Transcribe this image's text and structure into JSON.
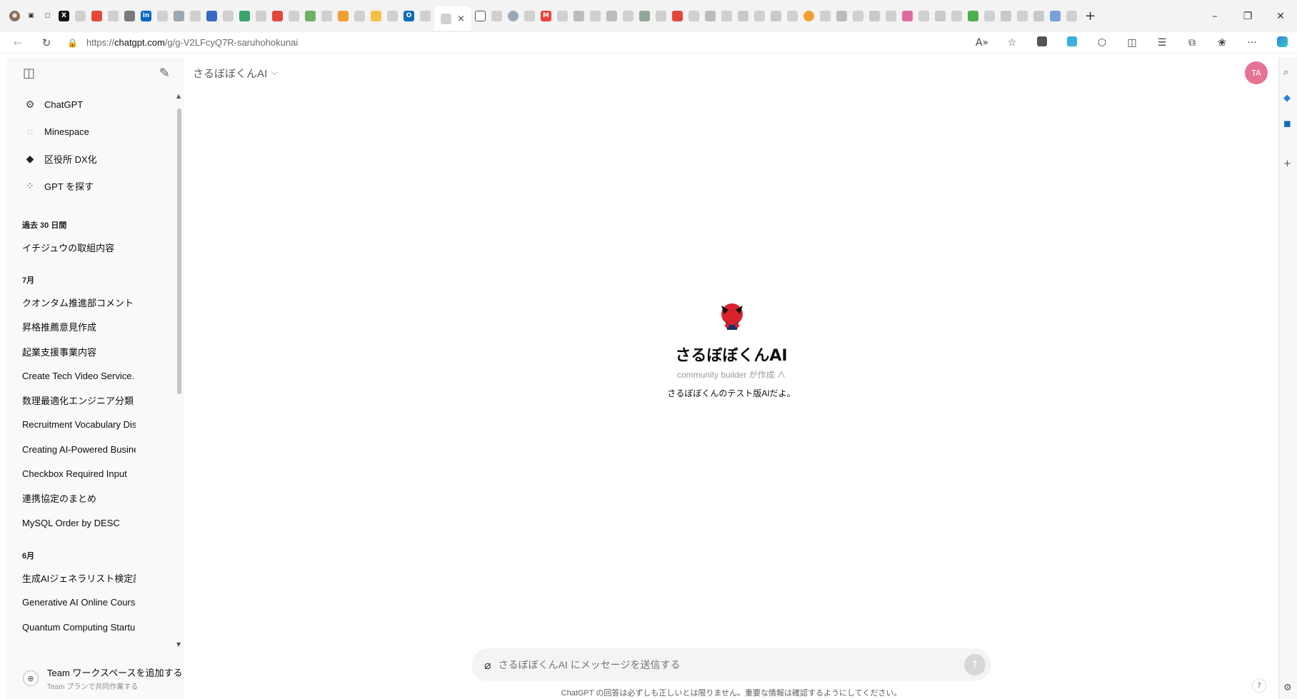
{
  "browser": {
    "url_prefix": "https://",
    "url_domain": "chatgpt.com",
    "url_path": "/g/g-V2LFcyQ7R-saruhohokunai",
    "tab_close": "×",
    "new_tab": "+",
    "win_min": "–",
    "win_restore": "❐",
    "win_close": "✕",
    "back": "←",
    "refresh": "↻",
    "lock": "🔒",
    "read_aloud": "A»",
    "favorite": "☆",
    "more": "···"
  },
  "sidebar": {
    "toggle_icon": "◫",
    "new_chat_icon": "✎",
    "gpts": [
      {
        "label": "ChatGPT",
        "icon": "⚙"
      },
      {
        "label": "Minespace",
        "icon": "◌"
      },
      {
        "label": "区役所 DX化",
        "icon": "◆"
      },
      {
        "label": "GPT を探す",
        "icon": "⁘"
      }
    ],
    "sections": [
      {
        "label": "過去 30 日間",
        "items": [
          "イチジュウの取組内容"
        ]
      },
      {
        "label": "7月",
        "items": [
          "クオンタム推進部コメント",
          "昇格推薦意見作成",
          "起業支援事業内容",
          "Create Tech Video Service.",
          "数理最適化エンジニア分類",
          "Recruitment Vocabulary Discuss",
          "Creating AI-Powered Business",
          "Checkbox Required Input",
          "連携協定のまとめ",
          "MySQL Order by DESC"
        ]
      },
      {
        "label": "6月",
        "items": [
          "生成AIジェネラリスト検定講座",
          "Generative AI Online Course",
          "Quantum Computing Startup."
        ]
      }
    ],
    "team": {
      "title": "Team ワークスペースを追加する",
      "subtitle": "Team プランで共同作業する",
      "icon": "⊕"
    },
    "scroll_up": "▲",
    "scroll_down": "▼"
  },
  "main": {
    "model_name": "さるぼぼくんAI",
    "model_chevron": "⌵",
    "avatar_initials": "TA",
    "gpt_name": "さるぼぼくんAI",
    "gpt_author": "community builder が作成 ∧",
    "gpt_description": "さるぼぼくんのテスト版AIだよ。",
    "composer_placeholder": "さるぼぼくんAI にメッセージを送信する",
    "attach_icon": "⌀",
    "send_icon": "↑",
    "disclaimer": "ChatGPT の回答は必ずしも正しいとは限りません。重要な情報は確認するようにしてください。",
    "help": "?"
  },
  "colors": {
    "accent_avatar": "#e57393",
    "gpt_red": "#d9232b"
  }
}
